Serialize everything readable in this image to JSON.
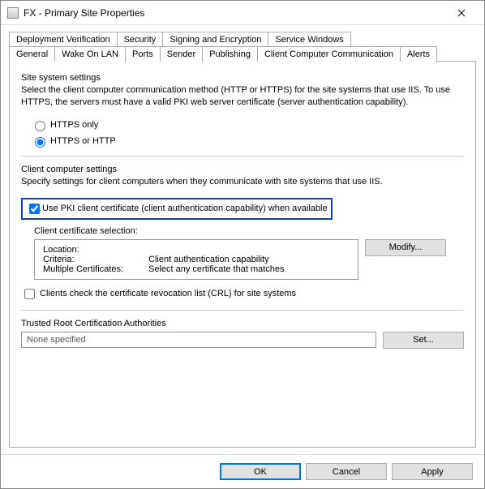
{
  "window": {
    "title": "FX - Primary Site Properties"
  },
  "tabs_row1": [
    "Deployment Verification",
    "Security",
    "Signing and Encryption",
    "Service Windows"
  ],
  "tabs_row2": [
    "General",
    "Wake On LAN",
    "Ports",
    "Sender",
    "Publishing",
    "Client Computer Communication",
    "Alerts"
  ],
  "active_tab": "Client Computer Communication",
  "site_settings": {
    "heading": "Site system settings",
    "description": "Select the client computer communication method (HTTP or HTTPS) for the site systems that use IIS. To use HTTPS, the servers must have a valid PKI web server certificate (server authentication capability).",
    "radio_https_only": "HTTPS only",
    "radio_https_or_http": "HTTPS or HTTP",
    "selected": "https_or_http"
  },
  "client_settings": {
    "heading": "Client computer settings",
    "description": "Specify settings for client computers when they communicate with site systems that use IIS.",
    "use_pki_label": "Use PKI client certificate (client authentication capability) when available",
    "use_pki_checked": true,
    "cert_selection_label": "Client certificate selection:",
    "cert": {
      "location_label": "Location:",
      "location_value": "",
      "criteria_label": "Criteria:",
      "criteria_value": "Client authentication capability",
      "multiple_label": "Multiple Certificates:",
      "multiple_value": "Select any certificate that matches"
    },
    "modify_btn": "Modify...",
    "crl_label": "Clients check the certificate revocation list (CRL) for site systems",
    "crl_checked": false
  },
  "trusted": {
    "heading": "Trusted Root Certification Authorities",
    "value": "None specified",
    "set_btn": "Set..."
  },
  "footer": {
    "ok": "OK",
    "cancel": "Cancel",
    "apply": "Apply"
  }
}
